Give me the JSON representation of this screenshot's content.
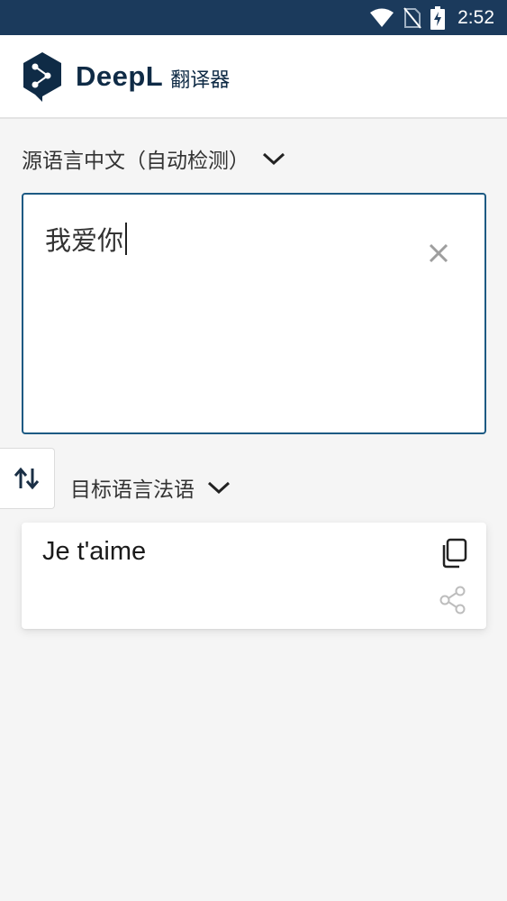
{
  "status_bar": {
    "time": "2:52",
    "icons": [
      "wifi-icon",
      "no-sim-icon",
      "battery-charging-icon"
    ],
    "background_color": "#1b3a5c"
  },
  "header": {
    "brand_name": "DeepL",
    "brand_suffix": "翻译器",
    "logo_icon": "deepl-logo-icon",
    "brand_color": "#0f2b46"
  },
  "source": {
    "label": "源语言中文（自动检测）",
    "input_value": "我爱你",
    "clear_icon": "close-icon",
    "border_color": "#1d5a83"
  },
  "swap": {
    "icon": "swap-vertical-icon"
  },
  "target": {
    "label": "目标语言法语",
    "translation": "Je t'aime",
    "copy_icon": "copy-icon",
    "share_icon": "share-icon"
  }
}
